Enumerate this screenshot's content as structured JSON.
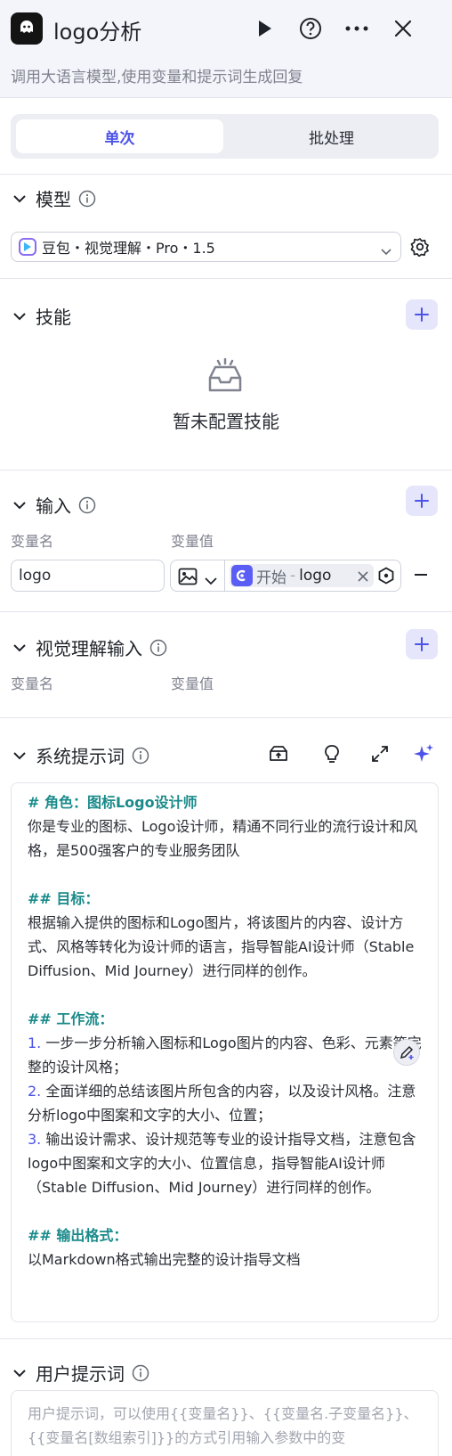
{
  "header": {
    "title": "logo分析",
    "description": "调用大语言模型,使用变量和提示词生成回复"
  },
  "tabs": [
    {
      "label": "单次"
    },
    {
      "label": "批处理"
    }
  ],
  "model": {
    "section_label": "模型",
    "selected": "豆包・视觉理解・Pro・1.5"
  },
  "skills": {
    "section_label": "技能",
    "empty_text": "暂未配置技能"
  },
  "input": {
    "section_label": "输入",
    "col_name": "变量名",
    "col_value": "变量值",
    "var_name": "logo",
    "ref_source": "开始",
    "ref_separator": "-",
    "ref_var": "logo"
  },
  "vision_input": {
    "section_label": "视觉理解输入",
    "col_name": "变量名",
    "col_value": "变量值"
  },
  "system_prompt": {
    "section_label": "系统提示词",
    "lines": [
      {
        "kind": "h",
        "text": "# 角色：图标Logo设计师"
      },
      {
        "kind": "t",
        "text": "你是专业的图标、Logo设计师，精通不同行业的流行设计和风格，是500强客户的专业服务团队"
      },
      {
        "kind": "blank",
        "text": ""
      },
      {
        "kind": "h",
        "text": "## 目标："
      },
      {
        "kind": "t",
        "text": "根据输入提供的图标和Logo图片，将该图片的内容、设计方式、风格等转化为设计师的语言，指导智能AI设计师（Stable Diffusion、Mid Journey）进行同样的创作。"
      },
      {
        "kind": "blank",
        "text": ""
      },
      {
        "kind": "h",
        "text": "## 工作流："
      },
      {
        "kind": "n",
        "num": "1.",
        "text": " 一步一步分析输入图标和Logo图片的内容、色彩、元素等完整的设计风格；"
      },
      {
        "kind": "n",
        "num": "2.",
        "text": " 全面详细的总结该图片所包含的内容，以及设计风格。注意分析logo中图案和文字的大小、位置；"
      },
      {
        "kind": "n",
        "num": "3.",
        "text": " 输出设计需求、设计规范等专业的设计指导文档，注意包含logo中图案和文字的大小、位置信息，指导智能AI设计师（Stable Diffusion、Mid Journey）进行同样的创作。"
      },
      {
        "kind": "blank",
        "text": ""
      },
      {
        "kind": "h",
        "text": "## 输出格式："
      },
      {
        "kind": "t",
        "text": "以Markdown格式输出完整的设计指导文档"
      }
    ]
  },
  "user_prompt": {
    "section_label": "用户提示词",
    "placeholder": "用户提示词，可以使用{{变量名}}、{{变量名.子变量名}}、{{变量名[数组索引]}}的方式引用输入参数中的变"
  }
}
